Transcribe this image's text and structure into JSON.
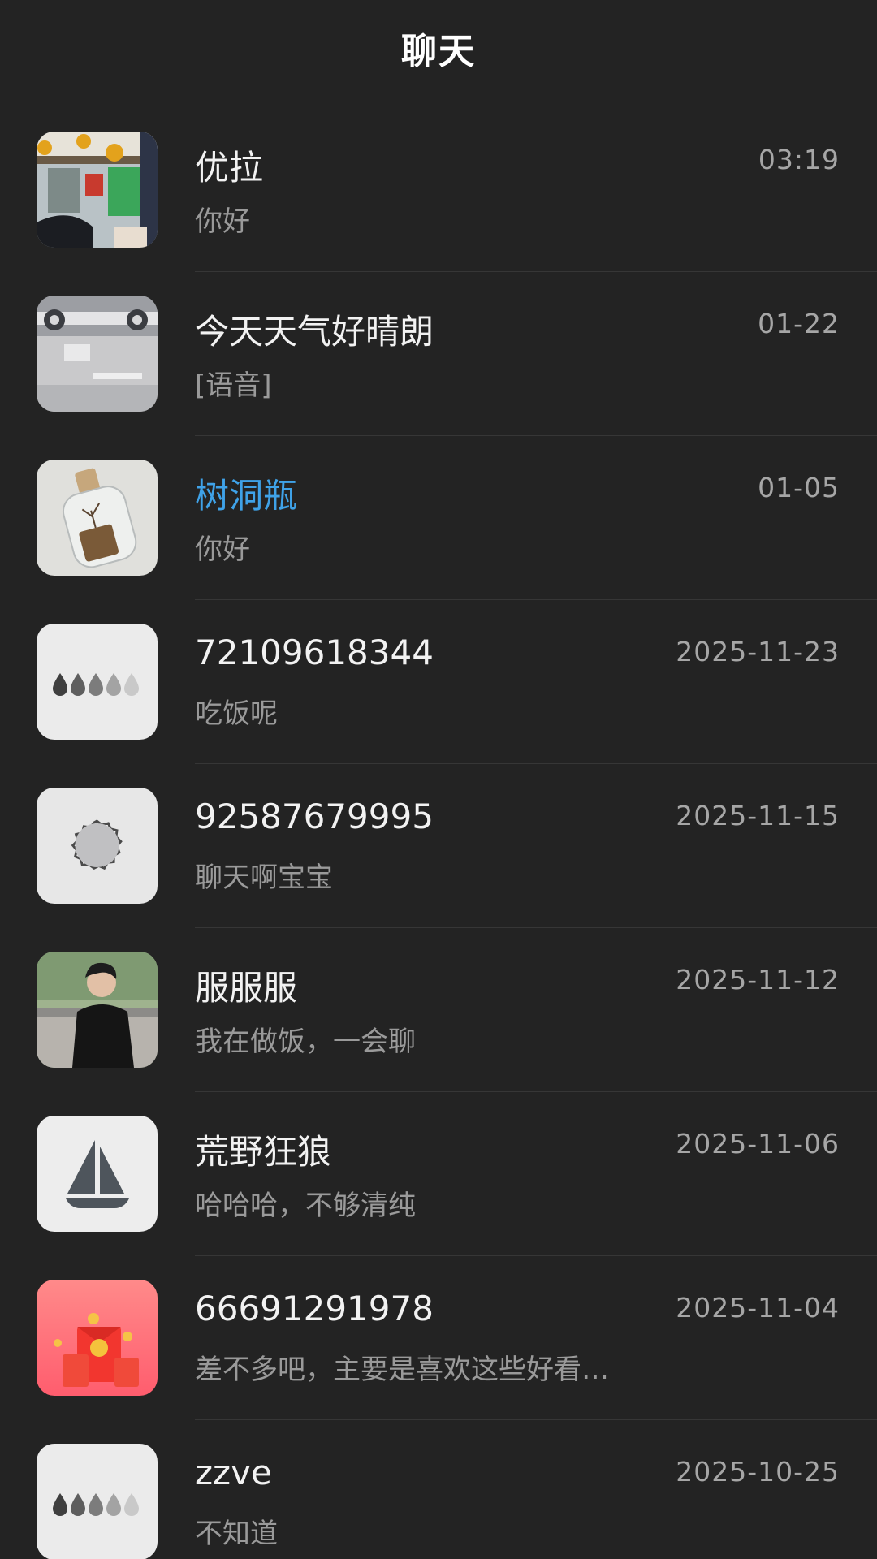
{
  "header": {
    "title": "聊天"
  },
  "chats": [
    {
      "name": "优拉",
      "preview": "你好",
      "time": "03:19",
      "name_color": "#f2f2f2",
      "avatar": "photo-street-icon"
    },
    {
      "name": "今天天气好晴朗",
      "preview": "[语音]",
      "time": "01-22",
      "name_color": "#f2f2f2",
      "avatar": "photo-room-icon"
    },
    {
      "name": "树洞瓶",
      "preview": "你好",
      "time": "01-05",
      "name_color": "#3fa2e8",
      "avatar": "bottle-icon"
    },
    {
      "name": "72109618344",
      "preview": "吃饭呢",
      "time": "2025-11-23",
      "name_color": "#f2f2f2",
      "avatar": "droplets-icon"
    },
    {
      "name": "92587679995",
      "preview": "聊天啊宝宝",
      "time": "2025-11-15",
      "name_color": "#f2f2f2",
      "avatar": "badge-circle-icon"
    },
    {
      "name": "服服服",
      "preview": "我在做饭，一会聊",
      "time": "2025-11-12",
      "name_color": "#f2f2f2",
      "avatar": "photo-person-icon"
    },
    {
      "name": "荒野狂狼",
      "preview": "哈哈哈，不够清纯",
      "time": "2025-11-06",
      "name_color": "#f2f2f2",
      "avatar": "sailboat-icon"
    },
    {
      "name": "66691291978",
      "preview": "差不多吧，主要是喜欢这些好看…",
      "time": "2025-11-04",
      "name_color": "#f2f2f2",
      "avatar": "red-envelope-icon"
    },
    {
      "name": "zzve",
      "preview": "不知道",
      "time": "2025-10-25",
      "name_color": "#f2f2f2",
      "avatar": "droplets-icon"
    }
  ]
}
